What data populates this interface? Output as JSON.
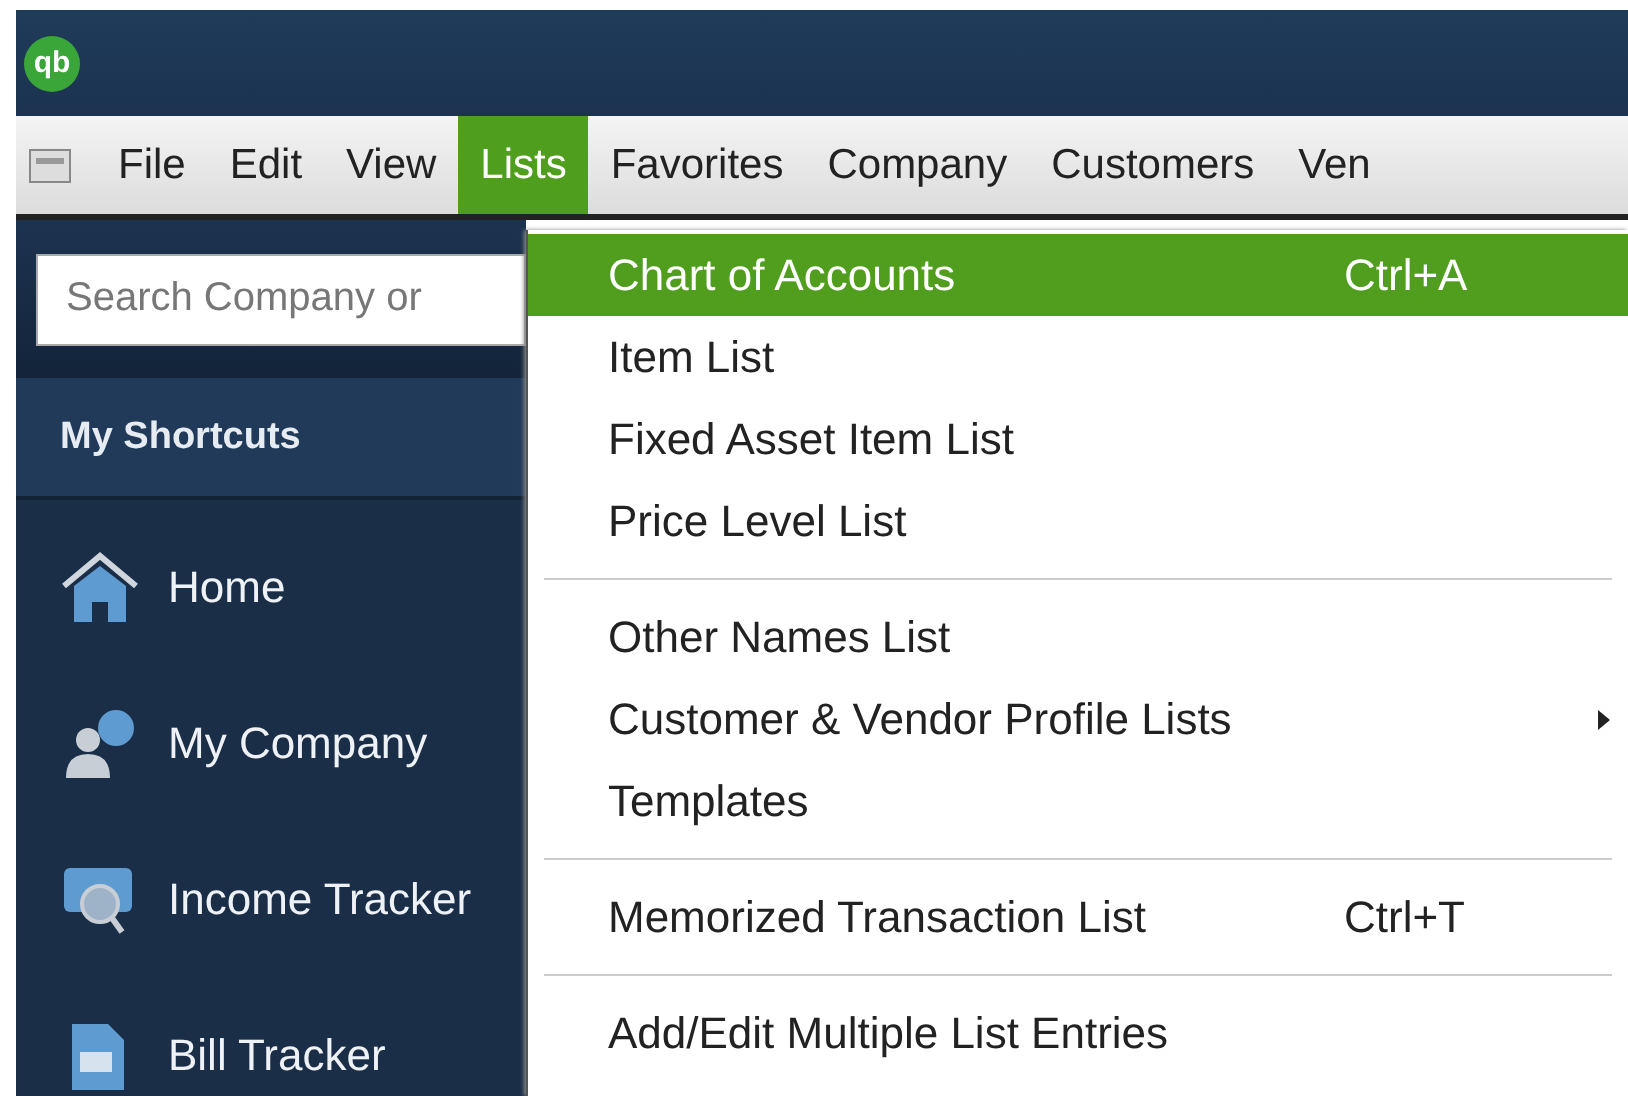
{
  "app_logo": {
    "text": "qb"
  },
  "menu_bar": [
    {
      "label": "File",
      "selected": false
    },
    {
      "label": "Edit",
      "selected": false
    },
    {
      "label": "View",
      "selected": false
    },
    {
      "label": "Lists",
      "selected": true
    },
    {
      "label": "Favorites",
      "selected": false
    },
    {
      "label": "Company",
      "selected": false
    },
    {
      "label": "Customers",
      "selected": false
    },
    {
      "label": "Ven",
      "selected": false
    }
  ],
  "sidebar": {
    "search": {
      "placeholder": "Search Company or"
    },
    "header": "My Shortcuts",
    "items": [
      {
        "label": "Home",
        "kind": "home"
      },
      {
        "label": "My Company",
        "kind": "company"
      },
      {
        "label": "Income Tracker",
        "kind": "income"
      },
      {
        "label": "Bill Tracker",
        "kind": "bill"
      }
    ]
  },
  "lists_menu": {
    "sections": [
      {
        "items": [
          {
            "label": "Chart of Accounts",
            "shortcut": "Ctrl+A",
            "selected": true,
            "submenu": false
          },
          {
            "label": "Item List",
            "selected": false,
            "submenu": false
          },
          {
            "label": "Fixed Asset Item List",
            "selected": false,
            "submenu": false
          },
          {
            "label": "Price Level List",
            "selected": false,
            "submenu": false
          }
        ]
      },
      {
        "items": [
          {
            "label": "Other Names List",
            "selected": false,
            "submenu": false
          },
          {
            "label": "Customer & Vendor Profile Lists",
            "selected": false,
            "submenu": true
          },
          {
            "label": "Templates",
            "selected": false,
            "submenu": false
          }
        ]
      },
      {
        "items": [
          {
            "label": "Memorized Transaction List",
            "shortcut": "Ctrl+T",
            "selected": false,
            "submenu": false
          }
        ]
      },
      {
        "items": [
          {
            "label": "Add/Edit Multiple List Entries",
            "selected": false,
            "submenu": false
          }
        ]
      }
    ]
  }
}
